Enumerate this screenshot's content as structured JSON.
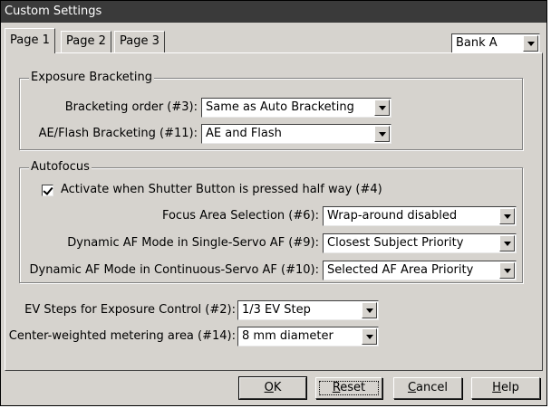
{
  "window": {
    "title": "Custom Settings"
  },
  "tabs": [
    {
      "label": "Page 1"
    },
    {
      "label": "Page 2"
    },
    {
      "label": "Page 3"
    }
  ],
  "bank": {
    "selected": "Bank A"
  },
  "exposure_bracketing": {
    "legend": "Exposure Bracketing",
    "order_label": "Bracketing order (#3):",
    "order_value": "Same as Auto Bracketing",
    "ae_label": "AE/Flash Bracketing (#11):",
    "ae_value": "AE and Flash"
  },
  "autofocus": {
    "legend": "Autofocus",
    "activate_checkbox": {
      "label": "Activate when Shutter Button is pressed half way (#4)",
      "checked": true
    },
    "focus_area_label": "Focus Area Selection (#6):",
    "focus_area_value": "Wrap-around disabled",
    "single_servo_label": "Dynamic AF Mode in Single-Servo AF (#9):",
    "single_servo_value": "Closest Subject Priority",
    "continuous_servo_label": "Dynamic AF Mode in Continuous-Servo AF (#10):",
    "continuous_servo_value": "Selected AF Area Priority"
  },
  "ev_steps": {
    "label": "EV Steps for Exposure Control (#2):",
    "value": "1/3 EV Step"
  },
  "metering": {
    "label": "Center-weighted metering area (#14):",
    "value": "8 mm diameter"
  },
  "buttons": {
    "ok": {
      "mnemonic": "O",
      "rest": "K"
    },
    "reset": {
      "mnemonic": "R",
      "rest": "eset"
    },
    "cancel": {
      "mnemonic": "C",
      "rest": "ancel"
    },
    "help": {
      "mnemonic": "H",
      "rest": "elp"
    }
  }
}
